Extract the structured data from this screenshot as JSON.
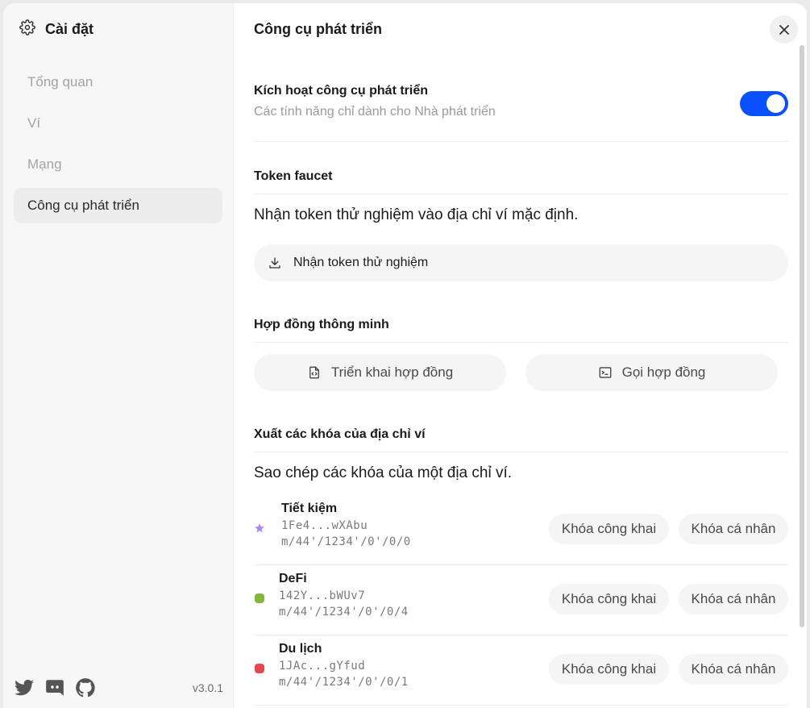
{
  "sidebar": {
    "title": "Cài đặt",
    "items": [
      {
        "label": "Tổng quan"
      },
      {
        "label": "Ví"
      },
      {
        "label": "Mạng"
      },
      {
        "label": "Công cụ phát triển",
        "active": true
      }
    ],
    "social": [
      "twitter-icon",
      "discord-icon",
      "github-icon"
    ],
    "version": "v3.0.1"
  },
  "main": {
    "title": "Công cụ phát triển",
    "dev_tools": {
      "title": "Kích hoạt công cụ phát triển",
      "description": "Các tính năng chỉ dành cho Nhà phát triển",
      "enabled": true
    },
    "faucet": {
      "title": "Token faucet",
      "description": "Nhận token thử nghiệm vào địa chỉ ví mặc định.",
      "button": "Nhận token thử nghiệm"
    },
    "contracts": {
      "title": "Hợp đồng thông minh",
      "deploy": "Triển khai hợp đồng",
      "call": "Gọi hợp đồng"
    },
    "keys": {
      "title": "Xuất các khóa của địa chỉ ví",
      "description": "Sao chép các khóa của một địa chỉ ví.",
      "public_label": "Khóa công khai",
      "private_label": "Khóa cá nhân",
      "accounts": [
        {
          "name": "Tiết kiệm",
          "address": "1Fe4...wXAbu",
          "path": "m/44'/1234'/0'/0/0",
          "marker": "star-icon",
          "color": "#a78bfa"
        },
        {
          "name": "DeFi",
          "address": "142Y...bWUv7",
          "path": "m/44'/1234'/0'/0/4",
          "marker": "dot",
          "color": "#84b63b"
        },
        {
          "name": "Du lịch",
          "address": "1JAc...gYfud",
          "path": "m/44'/1234'/0'/0/1",
          "marker": "dot",
          "color": "#e5484d"
        }
      ]
    }
  },
  "colors": {
    "accent": "#0a50ff",
    "sidebar_bg": "#f7f7f7"
  }
}
